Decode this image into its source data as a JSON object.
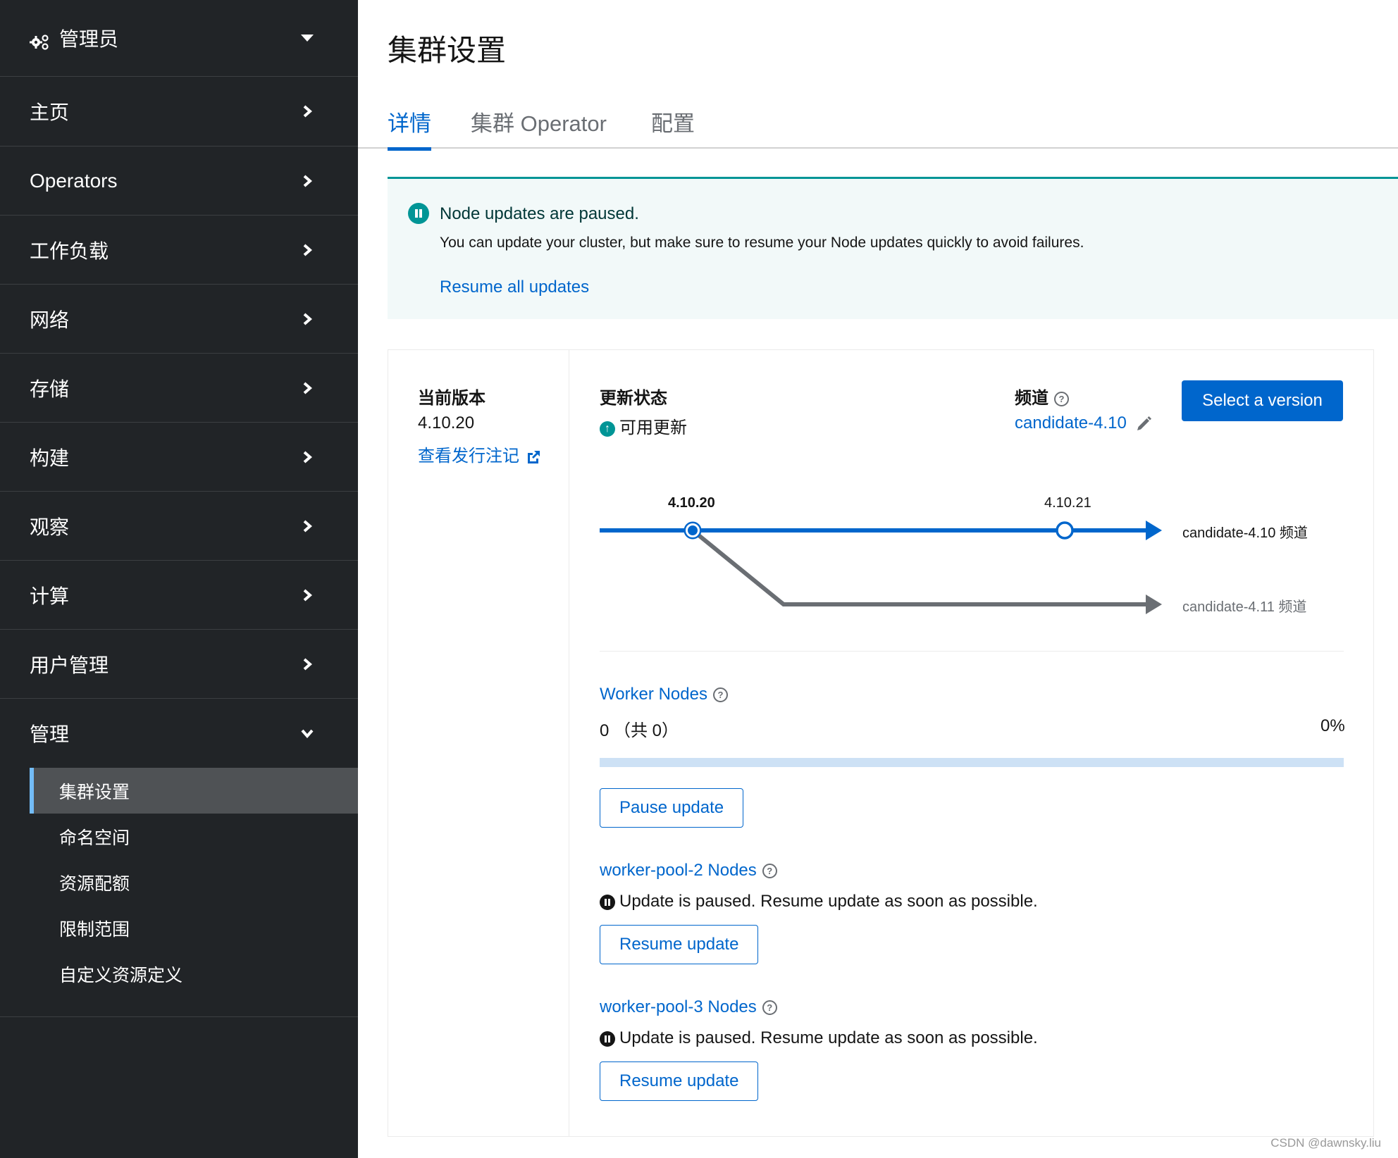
{
  "sidebar": {
    "perspective": {
      "label": "管理员",
      "icon": "gears-icon"
    },
    "sections": [
      {
        "label": "主页",
        "expanded": false
      },
      {
        "label": "Operators",
        "expanded": false
      },
      {
        "label": "工作负载",
        "expanded": false
      },
      {
        "label": "网络",
        "expanded": false
      },
      {
        "label": "存储",
        "expanded": false
      },
      {
        "label": "构建",
        "expanded": false
      },
      {
        "label": "观察",
        "expanded": false
      },
      {
        "label": "计算",
        "expanded": false
      },
      {
        "label": "用户管理",
        "expanded": false
      },
      {
        "label": "管理",
        "expanded": true
      }
    ],
    "admin_items": [
      {
        "label": "集群设置",
        "active": true
      },
      {
        "label": "命名空间",
        "active": false
      },
      {
        "label": "资源配额",
        "active": false
      },
      {
        "label": "限制范围",
        "active": false
      },
      {
        "label": "自定义资源定义",
        "active": false
      }
    ]
  },
  "page": {
    "title": "集群设置",
    "tabs": [
      {
        "label": "详情",
        "active": true
      },
      {
        "label": "集群 Operator",
        "active": false
      },
      {
        "label": "配置",
        "active": false
      }
    ]
  },
  "alert": {
    "title": "Node updates are paused.",
    "body": "You can update your cluster, but make sure to resume your Node updates quickly to avoid failures.",
    "link": "Resume all updates",
    "color": "#009596"
  },
  "details": {
    "current_version": {
      "label": "当前版本",
      "value": "4.10.20",
      "release_notes": "查看发行注记"
    },
    "update_status": {
      "label": "更新状态",
      "value": "可用更新"
    },
    "channel": {
      "label": "频道",
      "value": "candidate-4.10",
      "help": "?"
    },
    "select_version_button": "Select a version",
    "graph": {
      "current_version": "4.10.20",
      "next_version": "4.10.21",
      "channels": [
        {
          "name": "candidate-4.10 频道",
          "color": "#0066cc"
        },
        {
          "name": "candidate-4.11 频道",
          "color": "#6a6e73"
        }
      ]
    },
    "worker_nodes": {
      "title": "Worker Nodes",
      "count_text": "0 （共 0）",
      "percent_text": "0%",
      "progress": 0,
      "button": "Pause update"
    },
    "pools": [
      {
        "title": "worker-pool-2 Nodes",
        "status": "Update is paused. Resume update as soon as possible.",
        "button": "Resume update"
      },
      {
        "title": "worker-pool-3 Nodes",
        "status": "Update is paused. Resume update as soon as possible.",
        "button": "Resume update"
      }
    ]
  },
  "watermark": "CSDN @dawnsky.liu"
}
